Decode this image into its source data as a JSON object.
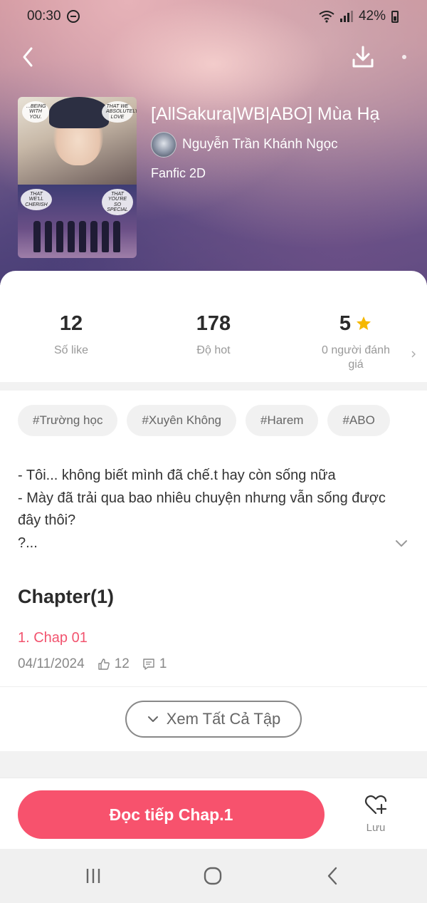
{
  "status_bar": {
    "time": "00:30",
    "battery": "42%"
  },
  "book": {
    "title": "[AllSakura|WB|ABO] Mùa Hạ",
    "author": "Nguyễn Trần Khánh Ngọc",
    "category": "Fanfic 2D"
  },
  "cover": {
    "bubbles": [
      "...BEING WITH YOU.",
      "THAT WE ABSOLUTELY LOVE",
      "THAT WE'LL CHERISH",
      "THAT YOU'RE SO SPECIAL"
    ]
  },
  "stats": [
    {
      "value": "12",
      "label": "Số like"
    },
    {
      "value": "178",
      "label": "Độ hot"
    },
    {
      "value": "5",
      "label": "0 người đánh giá"
    }
  ],
  "tags": [
    "#Trường học",
    "#Xuyên Không",
    "#Harem",
    "#ABO"
  ],
  "description": [
    "- Tôi... không biết mình đã chế.t hay còn sống nữa",
    "- Mày đã trải qua bao nhiêu chuyện nhưng vẫn sống được đây thôi?",
    "?..."
  ],
  "chapters": {
    "heading": "Chapter(1)",
    "items": [
      {
        "title": "1. Chap 01",
        "date": "04/11/2024",
        "likes": "12",
        "comments": "1"
      }
    ],
    "see_all": "Xem Tất Cả Tập"
  },
  "actions": {
    "read_label": "Đọc tiếp Chap.1",
    "save_label": "Lưu"
  },
  "colors": {
    "accent": "#f7526d",
    "chapter_link": "#f2546f",
    "star": "#f5b800"
  },
  "icons": [
    "back-arrow-icon",
    "download-icon",
    "more-icon",
    "star-icon",
    "chevron-down-icon",
    "thumb-up-icon",
    "comment-icon",
    "heart-plus-icon"
  ]
}
